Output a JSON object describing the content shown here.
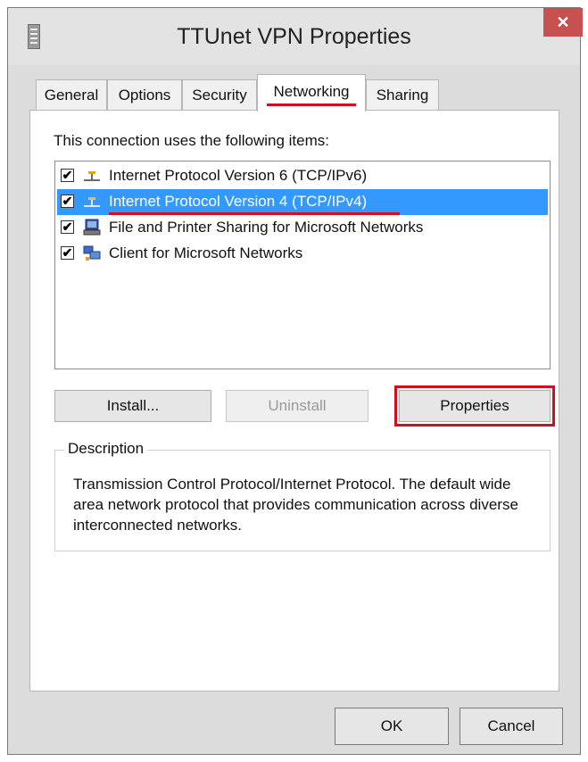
{
  "window": {
    "title": "TTUnet VPN Properties",
    "close_glyph": "✕"
  },
  "tabs": [
    {
      "label": "General"
    },
    {
      "label": "Options"
    },
    {
      "label": "Security"
    },
    {
      "label": "Networking",
      "active": true
    },
    {
      "label": "Sharing"
    }
  ],
  "networking": {
    "items_label": "This connection uses the following items:",
    "items": [
      {
        "label": "Internet Protocol Version 6 (TCP/IPv6)",
        "checked": true,
        "icon": "network-protocol-icon"
      },
      {
        "label": "Internet Protocol Version 4 (TCP/IPv4)",
        "checked": true,
        "selected": true,
        "icon": "network-protocol-icon"
      },
      {
        "label": "File and Printer Sharing for Microsoft Networks",
        "checked": true,
        "icon": "file-printer-sharing-icon"
      },
      {
        "label": "Client for Microsoft Networks",
        "checked": true,
        "icon": "network-client-icon"
      }
    ],
    "check_glyph": "✔",
    "buttons": {
      "install": "Install...",
      "uninstall": "Uninstall",
      "properties": "Properties"
    },
    "description": {
      "title": "Description",
      "text": "Transmission Control Protocol/Internet Protocol. The default wide area network protocol that provides communication across diverse interconnected networks."
    }
  },
  "dialog_buttons": {
    "ok": "OK",
    "cancel": "Cancel"
  },
  "colors": {
    "selection": "#3399ff",
    "annotation_red": "#d10f1f",
    "close_button": "#c75050"
  }
}
